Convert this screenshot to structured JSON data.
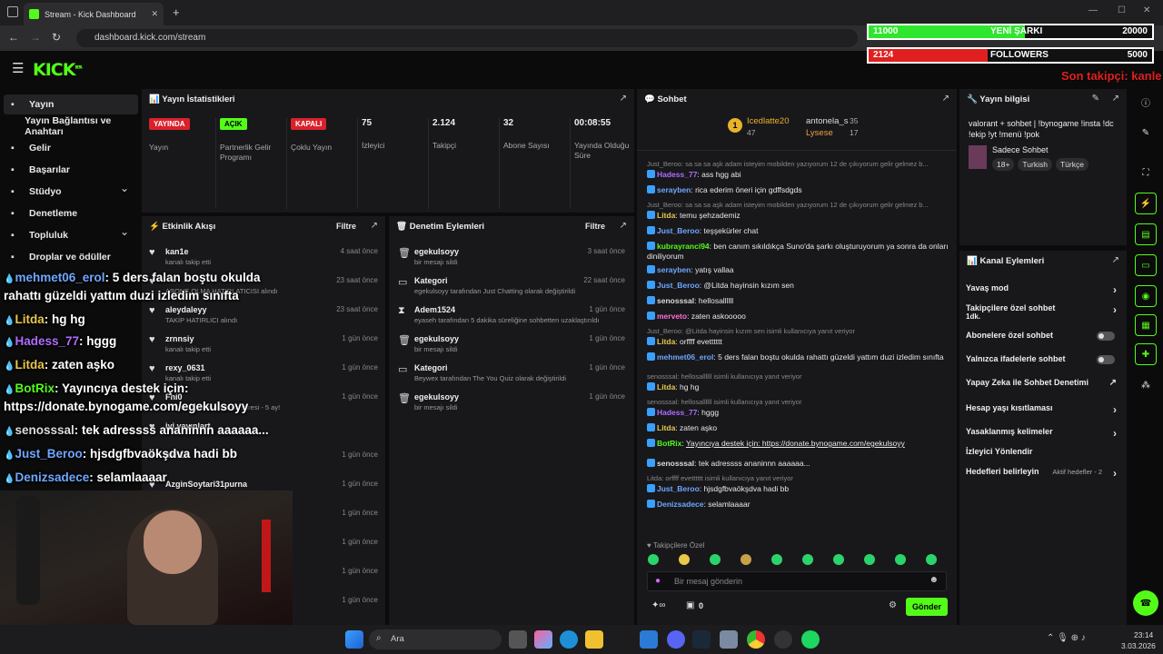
{
  "browser": {
    "tab_title": "Stream - Kick Dashboard",
    "url": "dashboard.kick.com/stream"
  },
  "kick": {
    "logo": "KICK",
    "logo_sup": "BETA"
  },
  "goals": [
    {
      "left": "11000",
      "label": "YENİ ŞARKI",
      "right": "20000",
      "color": "#2ee62e",
      "fill": 0.55
    },
    {
      "left": "2124",
      "label": "FOLLOWERS",
      "right": "5000",
      "color": "#e02020",
      "fill": 0.42
    }
  ],
  "follower_alert": "Son takipçi: kanle",
  "sidebar": {
    "items": [
      {
        "label": "Yayın",
        "icon": "broadcast-icon"
      },
      {
        "label": "Yayın Bağlantısı ve Anahtarı",
        "icon": ""
      },
      {
        "label": "Gelir",
        "icon": "revenue-icon"
      },
      {
        "label": "Başarılar",
        "icon": "trophy-icon"
      },
      {
        "label": "Stüdyo",
        "icon": "studio-icon"
      },
      {
        "label": "Denetleme",
        "icon": "wrench-icon"
      },
      {
        "label": "Topluluk",
        "icon": "megaphone-icon"
      },
      {
        "label": "Droplar ve ödüller",
        "icon": "gift-icon"
      }
    ]
  },
  "stats": {
    "title": "Yayın İstatistikleri",
    "items": [
      {
        "badge": "YAYINDA",
        "badge_color": "#d9212b",
        "label": "Yayın"
      },
      {
        "badge": "AÇIK",
        "badge_color": "#53fc18",
        "label": "Partnerlik Gelir Programı"
      },
      {
        "badge": "KAPALI",
        "badge_color": "#d9212b",
        "label": "Çoklu Yayın"
      },
      {
        "value": "75",
        "label": "İzleyici"
      },
      {
        "value": "2.124",
        "label": "Takipçi"
      },
      {
        "value": "32",
        "label": "Abone Sayısı"
      },
      {
        "value": "00:08:55",
        "label": "Yayında Olduğu Süre"
      }
    ]
  },
  "events": {
    "title": "Etkinlik Akışı",
    "filter": "Filtre",
    "items": [
      {
        "name": "kan1e",
        "sub": "kanalı takip etti",
        "time": "4 saat önce"
      },
      {
        "name": "",
        "sub": "ABONE OLMA HATIRLATICISI alındı",
        "time": "23 saat önce"
      },
      {
        "name": "aleydaleyy",
        "sub": "TAKİP HATIRLICI alındı",
        "time": "23 saat önce"
      },
      {
        "name": "zrnnsiy",
        "sub": "kanalı takip etti",
        "time": "1 gün önce"
      },
      {
        "name": "rexy_0631",
        "sub": "kanalı takip etti",
        "time": "1 gün önce"
      },
      {
        "name": "Fhi0",
        "sub": "...tuyor! Toplam abonelik süresi - 5 ay!",
        "time": "1 gün önce"
      },
      {
        "name": "iyi yayınlart",
        "sub": "",
        "time": ""
      },
      {
        "name": "kan1e",
        "sub": "",
        "time": "1 gün önce"
      },
      {
        "name": "AzginSoytari31purna",
        "sub": "SU HATIRLATICI alındı",
        "time": "1 gün önce"
      },
      {
        "name": "",
        "sub": "",
        "time": "1 gün önce"
      },
      {
        "name": "",
        "sub": "",
        "time": "1 gün önce"
      },
      {
        "name": "",
        "sub": "",
        "time": "1 gün önce"
      },
      {
        "name": "",
        "sub": "",
        "time": "1 gün önce"
      },
      {
        "name": "",
        "sub": "",
        "time": "1 gün önce"
      }
    ]
  },
  "moderation": {
    "title": "Denetim Eylemleri",
    "filter": "Filtre",
    "items": [
      {
        "icon": "trash-icon",
        "name": "egekulsoyy",
        "sub": "bir mesajı sildi",
        "time": "3 saat önce"
      },
      {
        "icon": "category-icon",
        "name": "Kategori",
        "sub": "egekulsoyy tarafından Just Chatting olarak değiştirildi",
        "time": "22 saat önce"
      },
      {
        "icon": "hourglass-icon",
        "name": "Adem1524",
        "sub": "eyaseh tarafından 5 dakika süreliğine sohbetten uzaklaştırıldı",
        "time": "1 gün önce"
      },
      {
        "icon": "trash-icon",
        "name": "egekulsoyy",
        "sub": "bir mesajı sildi",
        "time": "1 gün önce"
      },
      {
        "icon": "category-icon",
        "name": "Kategori",
        "sub": "Beywex tarafından The You Quiz olarak değiştirildi",
        "time": "1 gün önce"
      },
      {
        "icon": "trash-icon",
        "name": "egekulsoyy",
        "sub": "bir mesajı sildi",
        "time": "1 gün önce"
      }
    ]
  },
  "chat": {
    "title": "Sohbet",
    "leaders": [
      {
        "name": "Icedlatte20",
        "value": "47"
      },
      {
        "name": "antonela_s",
        "value": "35"
      },
      {
        "name": "Lysese",
        "value": "17"
      }
    ],
    "messages": [
      {
        "reply": "Just_Beroo: sa sa sa aşk adam isteyim mobilden yazıyorum 12 de çıkıyorum gelir gelmez b..."
      },
      {
        "user": "Hadess_77",
        "color": "#b06cff",
        "text": "ass hgg abi"
      },
      {
        "user": "serayben",
        "color": "#6fa7ff",
        "text": "rica ederim öneri için gdffsdgds"
      },
      {
        "reply": "Just_Beroo: sa sa sa aşk adam isteyim mobilden yazıyorum 12 de çıkıyorum gelir gelmez b..."
      },
      {
        "user": "Litda",
        "color": "#e8c84a",
        "text": "temu şehzademiz"
      },
      {
        "user": "Just_Beroo",
        "color": "#6fa7ff",
        "text": "teşşekürler chat"
      },
      {
        "user": "kubrayranci94",
        "color": "#53fc18",
        "text": "ben canım sıkıldıkça Suno'da şarkı oluşturuyorum ya sonra da onları diniliyorum"
      },
      {
        "user": "serayben",
        "color": "#6fa7ff",
        "text": "yatış vallaa"
      },
      {
        "user": "Just_Beroo",
        "color": "#6fa7ff",
        "text": "@Litda hayinsin kızım sen"
      },
      {
        "user": "senosssal",
        "color": "#ddd",
        "text": "hellosallllll"
      },
      {
        "user": "merveto",
        "color": "#ff6fd8",
        "text": "zaten askooooo"
      },
      {
        "reply": "Just_Beroo: @Litda hayinsin kızım sen isimli kullanıcıya yanıt veriyor"
      },
      {
        "user": "Litda",
        "color": "#e8c84a",
        "text": "orffff evetttttt"
      },
      {
        "user": "mehmet06_erol",
        "color": "#6fa7ff",
        "text": "5 ders falan boştu okulda rahattı güzeldi yattım duzi izledim sınıfta"
      },
      {
        "reply": "senosssal: hellosallllll isimli kullanıcıya yanıt veriyor"
      },
      {
        "user": "Litda",
        "color": "#e8c84a",
        "text": "hg hg"
      },
      {
        "reply": "senosssal: hellosallllll isimli kullanıcıya yanıt veriyor"
      },
      {
        "user": "Hadess_77",
        "color": "#b06cff",
        "text": "hggg"
      },
      {
        "user": "Litda",
        "color": "#e8c84a",
        "text": "zaten aşko"
      },
      {
        "user": "BotRix",
        "color": "#53fc18",
        "text": "Yayıncıya destek için: https://donate.bynogame.com/egekulsoyy"
      },
      {
        "user": "senosssal",
        "color": "#ddd",
        "text": "tek adressss ananinnn aaaaaa..."
      },
      {
        "reply": "Litda: orffff evetttttt isimli kullanıcıya yanıt veriyor"
      },
      {
        "user": "Just_Beroo",
        "color": "#6fa7ff",
        "text": "hjsdgfbvaökşdva hadi bb"
      },
      {
        "user": "Denizsadece",
        "color": "#6fa7ff",
        "text": "selamlaaaar"
      }
    ],
    "followers_only": "Takipçilere Özel",
    "placeholder": "Bir mesaj gönderin",
    "points": "0",
    "send": "Gönder"
  },
  "info": {
    "title": "Yayın bilgisi",
    "stream_title": "valorant + sohbet | !bynogame !insta !dc !ekip !yt !menü !pok",
    "category": "Sadece Sohbet",
    "tags": [
      "18+",
      "Turkish",
      "Türkçe"
    ]
  },
  "actions": {
    "title": "Kanal Eylemleri",
    "items": [
      {
        "label": "Yavaş mod",
        "ctl": "chev"
      },
      {
        "label": "Takipçilere özel sohbet",
        "sub": "1dk.",
        "ctl": "chev"
      },
      {
        "label": "Abonelere özel sohbet",
        "ctl": "tog"
      },
      {
        "label": "Yalnızca ifadelerle sohbet",
        "ctl": "tog"
      },
      {
        "label": "Yapay Zeka ile Sohbet Denetimi",
        "ctl": "ext"
      },
      {
        "label": "Hesap yaşı kısıtlaması",
        "ctl": "chev"
      },
      {
        "label": "Yasaklanmış kelimeler",
        "ctl": "chev"
      },
      {
        "label": "İzleyici Yönlendir",
        "ctl": ""
      },
      {
        "label": "Hedefleri belirleyin",
        "sub2": "Aktif hedefler - 2",
        "ctl": "chev"
      }
    ]
  },
  "overlay_chat": [
    {
      "user": "mehmet06_erol",
      "color": "#6fa7ff",
      "text": ": 5 ders falan boştu okulda"
    },
    {
      "user": "",
      "color": "#fff",
      "text": "rahattı güzeldi yattım duzi izledim sınıfta"
    },
    {
      "user": "Litda",
      "color": "#e8c84a",
      "text": ": hg hg"
    },
    {
      "user": "Hadess_77",
      "color": "#b06cff",
      "text": ": hggg"
    },
    {
      "user": "Litda",
      "color": "#e8c84a",
      "text": ": zaten aşko"
    },
    {
      "user": "BotRix",
      "color": "#53fc18",
      "text": ": Yayıncıya destek için:"
    },
    {
      "user": "",
      "color": "#fff",
      "text": "https://donate.bynogame.com/egekulsoyy"
    },
    {
      "user": "senosssal",
      "color": "#ddd",
      "text": ": tek adressss ananinnn aaaaaa..."
    },
    {
      "user": "Just_Beroo",
      "color": "#6fa7ff",
      "text": ": hjsdgfbvaökşdva hadi bb"
    },
    {
      "user": "Denizsadece",
      "color": "#6fa7ff",
      "text": ": selamlaaaar"
    }
  ],
  "taskbar": {
    "search": "Ara",
    "time": "23:14",
    "date": "3.03.2026"
  }
}
